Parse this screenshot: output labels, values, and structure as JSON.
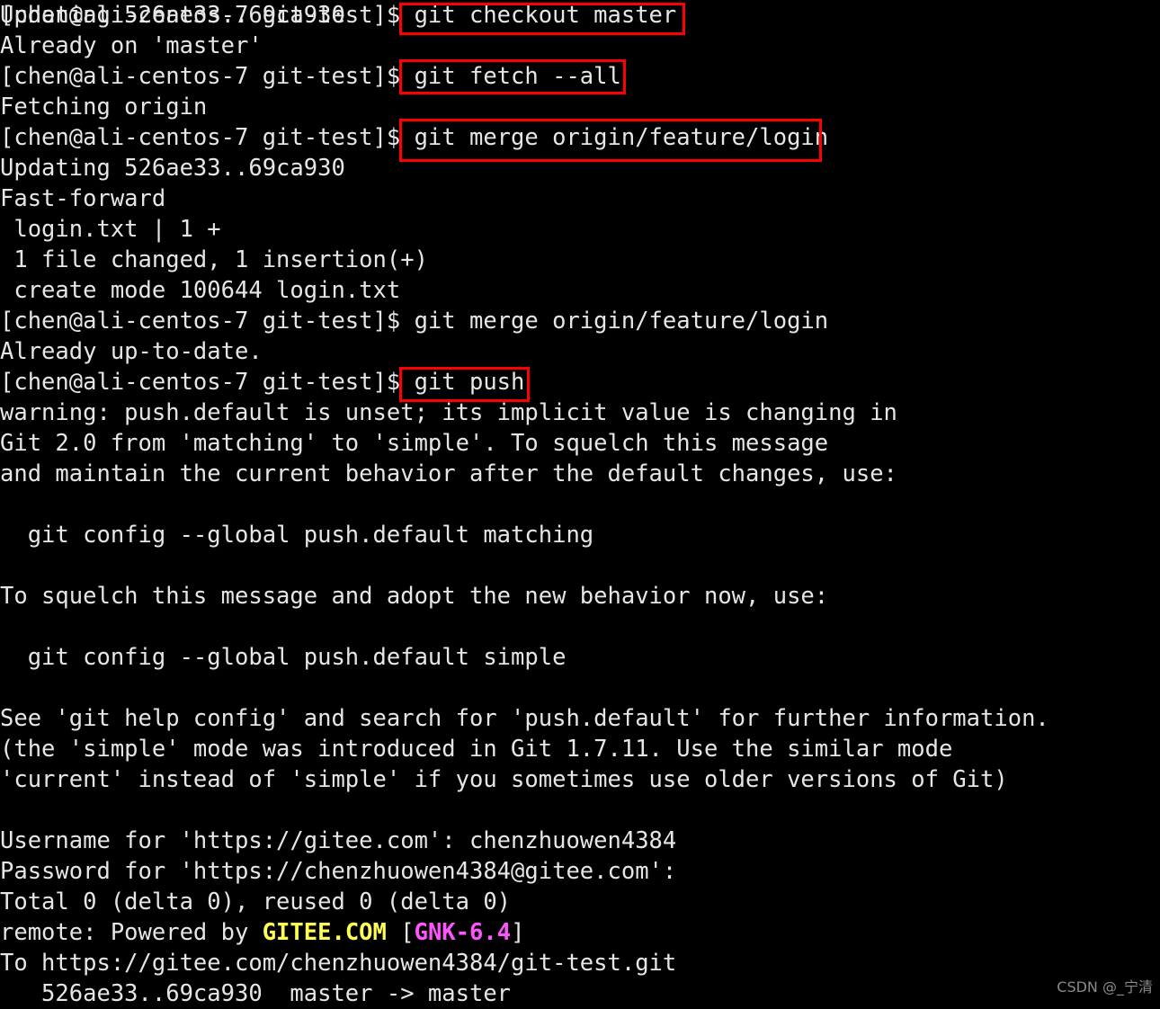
{
  "terminal": {
    "background_color": "#000000",
    "text_color": "#e6e6e6",
    "highlight_color": "#ff0000",
    "prompt": "[chen@ali-centos-7 git-test]$ ",
    "lines": [
      {
        "id": "l0",
        "text": "[chen@ali-centos-7 git-test]$ git checkout master"
      },
      {
        "id": "l1",
        "text": "Already on 'master'"
      },
      {
        "id": "l2",
        "text": "[chen@ali-centos-7 git-test]$ git fetch --all"
      },
      {
        "id": "l3",
        "text": "Fetching origin"
      },
      {
        "id": "l4",
        "text": "[chen@ali-centos-7 git-test]$ git merge origin/feature/login"
      },
      {
        "id": "l5",
        "text": "Updating 526ae33..69ca930"
      },
      {
        "id": "l6",
        "text": "Fast-forward"
      },
      {
        "id": "l7",
        "text": " login.txt | 1 +"
      },
      {
        "id": "l8",
        "text": " 1 file changed, 1 insertion(+)"
      },
      {
        "id": "l9",
        "text": " create mode 100644 login.txt"
      },
      {
        "id": "l10",
        "text": "[chen@ali-centos-7 git-test]$ git merge origin/feature/login"
      },
      {
        "id": "l11",
        "text": "Already up-to-date."
      },
      {
        "id": "l12",
        "text": "[chen@ali-centos-7 git-test]$ git push"
      },
      {
        "id": "l13",
        "text": "warning: push.default is unset; its implicit value is changing in"
      },
      {
        "id": "l14",
        "text": "Git 2.0 from 'matching' to 'simple'. To squelch this message"
      },
      {
        "id": "l15",
        "text": "and maintain the current behavior after the default changes, use:"
      },
      {
        "id": "l16",
        "text": ""
      },
      {
        "id": "l17",
        "text": "  git config --global push.default matching"
      },
      {
        "id": "l18",
        "text": ""
      },
      {
        "id": "l19",
        "text": "To squelch this message and adopt the new behavior now, use:"
      },
      {
        "id": "l20",
        "text": ""
      },
      {
        "id": "l21",
        "text": "  git config --global push.default simple"
      },
      {
        "id": "l22",
        "text": ""
      },
      {
        "id": "l23",
        "text": "See 'git help config' and search for 'push.default' for further information."
      },
      {
        "id": "l24",
        "text": "(the 'simple' mode was introduced in Git 1.7.11. Use the similar mode"
      },
      {
        "id": "l25",
        "text": "'current' instead of 'simple' if you sometimes use older versions of Git)"
      },
      {
        "id": "l26",
        "text": ""
      },
      {
        "id": "l27",
        "text": "Username for 'https://gitee.com': chenzhuowen4384"
      },
      {
        "id": "l28",
        "text": "Password for 'https://chenzhuowen4384@gitee.com':"
      },
      {
        "id": "l29",
        "text": "Total 0 (delta 0), reused 0 (delta 0)"
      },
      {
        "id": "l31",
        "text": "To https://gitee.com/chenzhuowen4384/git-test.git"
      },
      {
        "id": "l32",
        "text": "   526ae33..69ca930  master -> master"
      }
    ],
    "remote_line": {
      "prefix": "remote: Powered by ",
      "brand": "GITEE.COM",
      "brand_color": "#ffff55",
      "bracket_open": " [",
      "version": "GNK-6.4",
      "version_color": "#ff55ff",
      "bracket_close": "]"
    },
    "highlight_boxes": [
      {
        "id": "box-checkout",
        "label": "git checkout master"
      },
      {
        "id": "box-fetch",
        "label": "git fetch --all"
      },
      {
        "id": "box-merge",
        "label": "git merge origin/feature/login"
      },
      {
        "id": "box-push",
        "label": "git push"
      }
    ]
  },
  "watermark": {
    "text": "CSDN @_宁清"
  }
}
